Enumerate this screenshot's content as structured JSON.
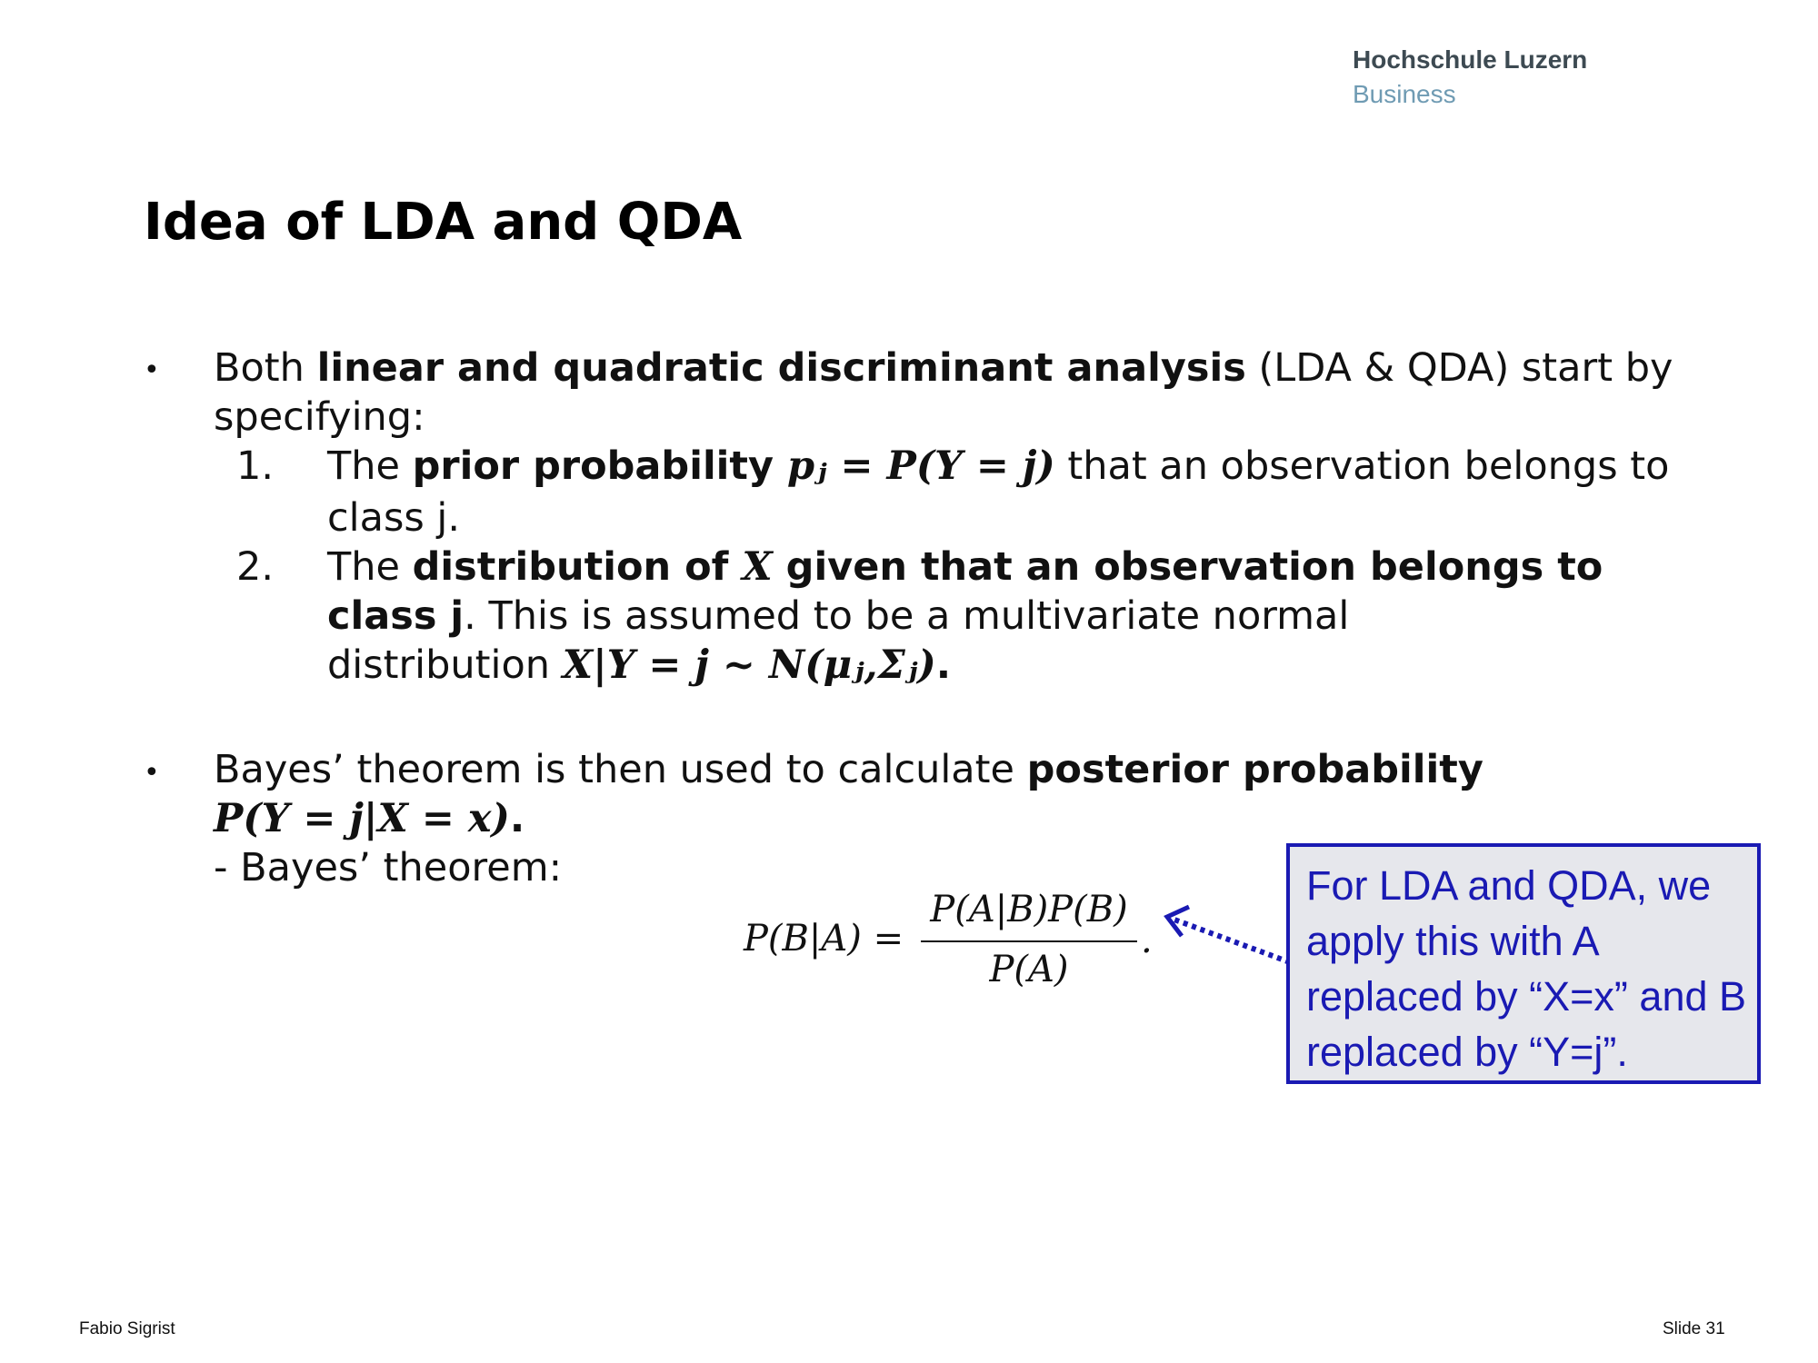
{
  "logo": {
    "line1": "Hochschule Luzern",
    "line2": "Business"
  },
  "title": "Idea of LDA and QDA",
  "bullet_glyph": "•",
  "bullet1": {
    "pre": "Both ",
    "bold": "linear and quadratic discriminant analysis",
    "post": " (LDA & QDA) start by",
    "line2": "specifying:",
    "item1": {
      "number": "1.",
      "pre": "The ",
      "bold": "prior probability ",
      "math": "pⱼ = P(Y = j)",
      "post": " that an observation belongs to",
      "line2": "class j."
    },
    "item2": {
      "number": "2.",
      "pre": "The ",
      "bold": "distribution of ",
      "math_x": "X",
      "bold2": " given that an observation belongs to",
      "line2_bold": "class j",
      "line2_post": ". This is assumed to be a multivariate normal",
      "line3_pre": "distribution ",
      "line3_math": "X|Y = j ~ N(μⱼ,Σⱼ)",
      "line3_post": "."
    }
  },
  "bullet2": {
    "pre": "Bayes’ theorem is then used to calculate ",
    "bold": "posterior probability",
    "math": "P(Y = j|X = x)",
    "math_post": ".",
    "sub": "- Bayes’ theorem:"
  },
  "formula": {
    "lhs": "P(B|A) =",
    "numerator": "P(A|B)P(B)",
    "denominator": "P(A)",
    "period": "."
  },
  "callout": {
    "text": "For LDA and QDA, we apply this with A replaced by “X=x” and B replaced by “Y=j”."
  },
  "footer": {
    "author": "Fabio Sigrist",
    "slide": "Slide 31"
  },
  "colors": {
    "callout_border": "#1a1ab3",
    "callout_fill": "#e6e7ec",
    "logo_dark": "#3d4a52",
    "logo_light": "#6f9bb3"
  }
}
